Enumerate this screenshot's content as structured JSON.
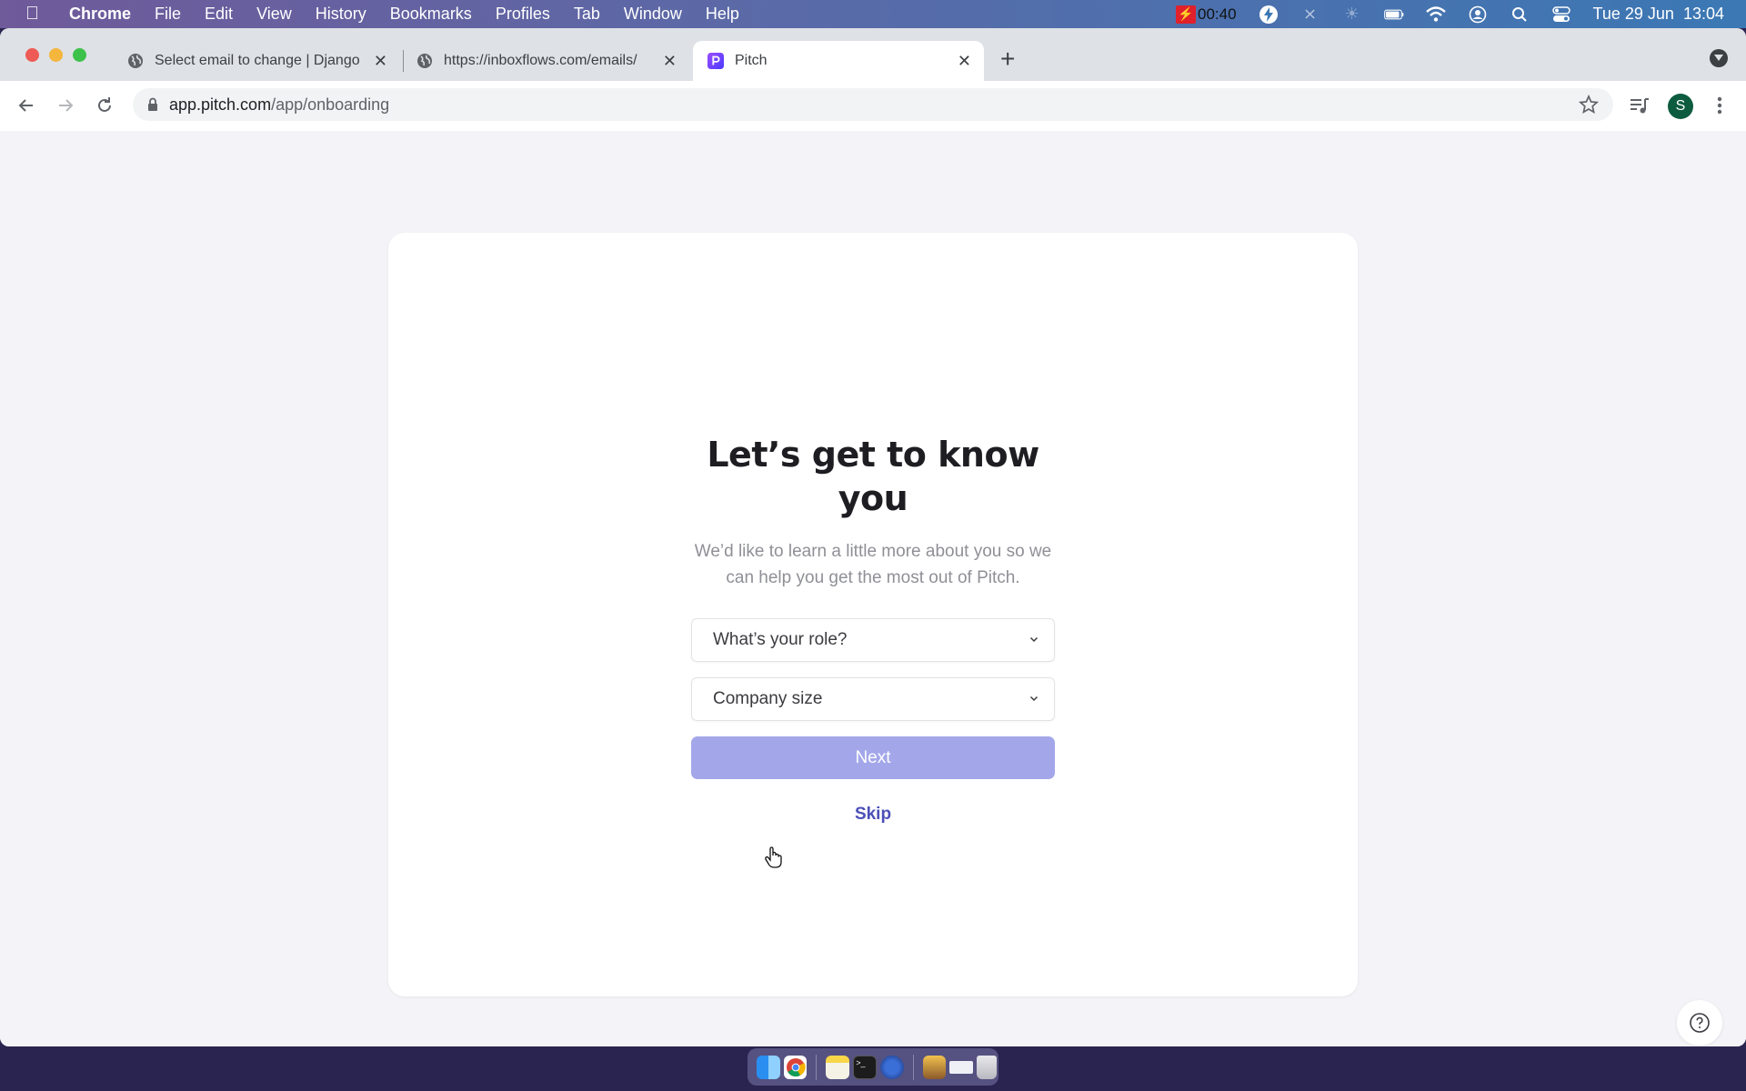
{
  "menubar": {
    "app_name": "Chrome",
    "menus": [
      "File",
      "Edit",
      "View",
      "History",
      "Bookmarks",
      "Profiles",
      "Tab",
      "Window",
      "Help"
    ],
    "recording_timer": "00:40",
    "datetime": "Tue 29 Jun  13:04",
    "status_icons": [
      "recording-icon",
      "bolt-icon",
      "bluetooth-icon",
      "brightness-icon",
      "battery-icon",
      "wifi-icon",
      "user-icon",
      "search-icon",
      "control-center-icon"
    ]
  },
  "browser": {
    "tabs": [
      {
        "title": "Select email to change | Django",
        "favicon": "globe-icon",
        "active": false
      },
      {
        "title": "https://inboxflows.com/emails/",
        "favicon": "globe-icon",
        "active": false
      },
      {
        "title": "Pitch",
        "favicon": "pitch-logo",
        "active": true
      }
    ],
    "new_tab_label": "+",
    "url_domain": "app.pitch.com",
    "url_path": "/app/onboarding",
    "profile_initial": "S",
    "profile_color": "#0d5c3f"
  },
  "onboarding": {
    "title": "Let’s get to know you",
    "subtitle": "We’d like to learn a little more about you so we can help you get the most out of Pitch.",
    "role_select": {
      "placeholder": "What’s your role?",
      "value": ""
    },
    "company_size_select": {
      "placeholder": "Company size",
      "value": ""
    },
    "next_label": "Next",
    "next_enabled": false,
    "skip_label": "Skip",
    "accent_color": "#4b4fb8",
    "disabled_button_color": "#a3a7ea"
  },
  "help_button": {
    "icon": "question-icon"
  },
  "dock": {
    "apps": [
      "finder",
      "chrome",
      "notes",
      "terminal",
      "reeder",
      "archive-utility",
      "screenshot-tool",
      "trash"
    ]
  }
}
